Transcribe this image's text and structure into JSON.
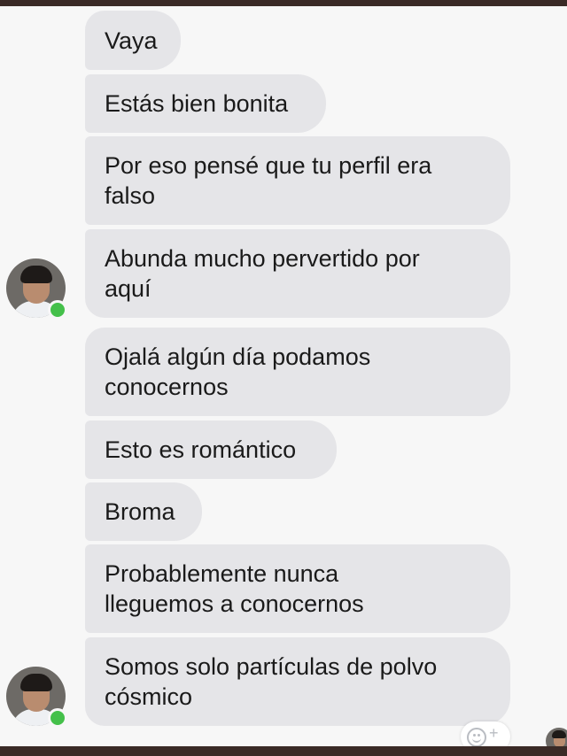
{
  "messages": [
    {
      "text": "Vaya"
    },
    {
      "text": "Estás bien bonita"
    },
    {
      "text": "Por eso pensé que tu perfil era\nfalso"
    },
    {
      "text": "Abunda mucho pervertido por\naquí"
    },
    {
      "text": "Ojalá algún día podamos\nconocernos"
    },
    {
      "text": "Esto es romántico"
    },
    {
      "text": "Broma"
    },
    {
      "text": "Probablemente nunca\nlleguemos a conocernos"
    },
    {
      "text": "Somos solo partículas de polvo\ncósmico"
    }
  ],
  "icons": {
    "sender_avatar": "avatar-icon",
    "online_indicator": "online-dot-icon",
    "reaction": "add-reaction-icon",
    "read_receipt": "seen-avatar-icon"
  },
  "colors": {
    "bubble": "#e5e5e8",
    "online": "#44c04a",
    "frame": "#3a2a26"
  }
}
